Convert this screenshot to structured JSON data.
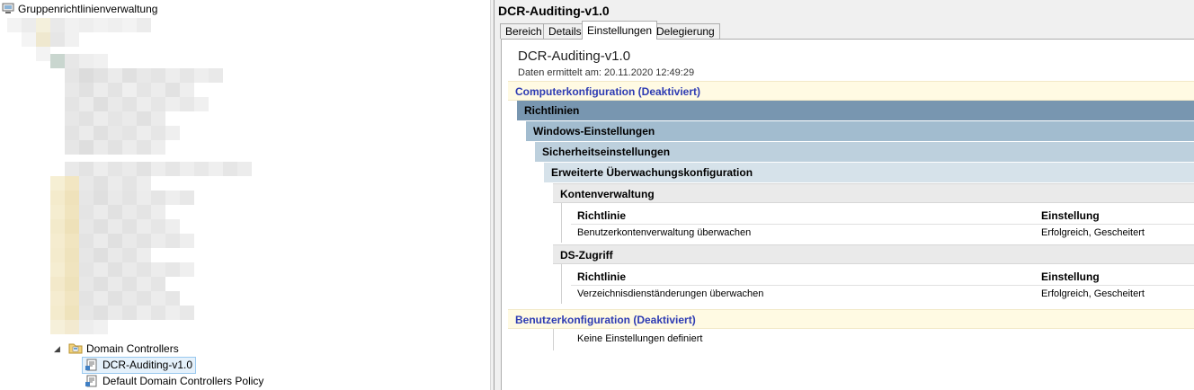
{
  "tree": {
    "root_label": "Gruppenrichtlinienverwaltung",
    "domain_controllers_label": "Domain Controllers",
    "children": [
      {
        "label": "DCR-Auditing-v1.0",
        "selected": true
      },
      {
        "label": "Default Domain Controllers Policy",
        "selected": false
      }
    ],
    "icons": {
      "root": "gpm-console-icon",
      "folder": "ou-folder-icon",
      "gpo": "gpo-link-icon",
      "expander": "collapse-triangle-icon"
    }
  },
  "pane": {
    "title": "DCR-Auditing-v1.0",
    "tabs": [
      "Bereich",
      "Details",
      "Einstellungen",
      "Delegierung"
    ],
    "active_tab": "Einstellungen"
  },
  "report": {
    "name": "DCR-Auditing-v1.0",
    "date_line": "Daten ermittelt am: 20.11.2020 12:49:29",
    "computer_section": "Computerkonfiguration (Deaktiviert)",
    "levels": {
      "richtlinien": "Richtlinien",
      "windows": "Windows-Einstellungen",
      "security": "Sicherheitseinstellungen",
      "advanced_audit": "Erweiterte Überwachungskonfiguration"
    },
    "groups": [
      {
        "title": "Kontenverwaltung",
        "col_policy": "Richtlinie",
        "col_setting": "Einstellung",
        "rows": [
          {
            "policy": "Benutzerkontenverwaltung überwachen",
            "setting": "Erfolgreich, Gescheitert"
          }
        ]
      },
      {
        "title": "DS-Zugriff",
        "col_policy": "Richtlinie",
        "col_setting": "Einstellung",
        "rows": [
          {
            "policy": "Verzeichnisdienständerungen überwachen",
            "setting": "Erfolgreich, Gescheitert"
          }
        ]
      }
    ],
    "user_section": "Benutzerkonfiguration (Deaktiviert)",
    "user_none": "Keine Einstellungen definiert"
  },
  "colors": {
    "accent_text": "#2d3bb3",
    "section_bg": "#fffae3",
    "level1": "#7896b0",
    "selection": "#e5f1fb"
  }
}
